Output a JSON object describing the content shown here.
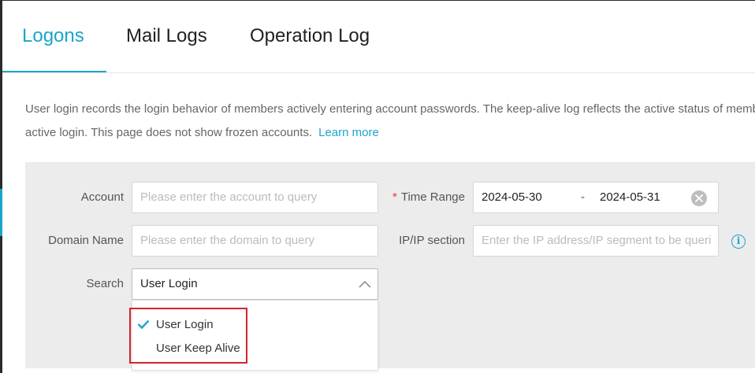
{
  "tabs": [
    {
      "label": "Logons",
      "active": true
    },
    {
      "label": "Mail Logs",
      "active": false
    },
    {
      "label": "Operation Log",
      "active": false
    }
  ],
  "description": {
    "line1": "User login records the login behavior of members actively entering account passwords. The keep-alive log reflects the active status of memb",
    "line2": "active login. This page does not show frozen accounts.",
    "learn_more": "Learn more"
  },
  "filters": {
    "account": {
      "label": "Account",
      "placeholder": "Please enter the account to query"
    },
    "time_range": {
      "required_mark": "*",
      "label": "Time Range",
      "start": "2024-05-30",
      "separator": "-",
      "end": "2024-05-31"
    },
    "domain": {
      "label": "Domain Name",
      "placeholder": "Please enter the domain to query"
    },
    "ip": {
      "label": "IP/IP section",
      "placeholder": "Enter the IP address/IP segment to be queri"
    },
    "search": {
      "label": "Search",
      "selected": "User Login"
    }
  },
  "dropdown": {
    "options": [
      {
        "label": "User Login",
        "selected": true
      },
      {
        "label": "User Keep Alive",
        "selected": false
      }
    ]
  },
  "icons": {
    "info": "info-icon",
    "info_glyph": "i",
    "clear": "clear-icon",
    "chevron": "chevron-up-icon",
    "check": "check-icon"
  },
  "colors": {
    "accent": "#1ba5c9",
    "required": "#e53935",
    "highlight": "#d6232c",
    "panel": "#ececec"
  }
}
